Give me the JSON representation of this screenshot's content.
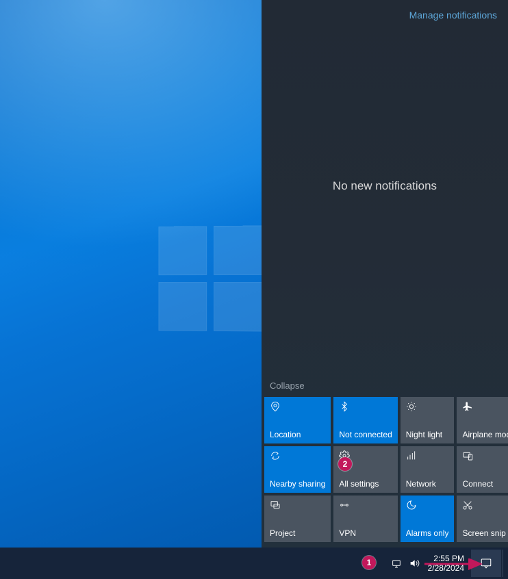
{
  "action_center": {
    "manage_link": "Manage notifications",
    "empty_message": "No new notifications",
    "collapse_label": "Collapse",
    "tiles": [
      {
        "label": "Location",
        "icon": "location-icon",
        "active": true
      },
      {
        "label": "Not connected",
        "icon": "bluetooth-icon",
        "active": true
      },
      {
        "label": "Night light",
        "icon": "sun-icon",
        "active": false
      },
      {
        "label": "Airplane mode",
        "icon": "airplane-icon",
        "active": false
      },
      {
        "label": "Nearby sharing",
        "icon": "share-icon",
        "active": true
      },
      {
        "label": "All settings",
        "icon": "gear-icon",
        "active": false
      },
      {
        "label": "Network",
        "icon": "network-icon",
        "active": false
      },
      {
        "label": "Connect",
        "icon": "connect-icon",
        "active": false
      },
      {
        "label": "Project",
        "icon": "project-icon",
        "active": false
      },
      {
        "label": "VPN",
        "icon": "vpn-icon",
        "active": false
      },
      {
        "label": "Alarms only",
        "icon": "moon-icon",
        "active": true
      },
      {
        "label": "Screen snip",
        "icon": "snip-icon",
        "active": false
      }
    ]
  },
  "taskbar": {
    "time": "2:55 PM",
    "date": "2/28/2024"
  },
  "annotations": {
    "marker1": "1",
    "marker2": "2"
  }
}
